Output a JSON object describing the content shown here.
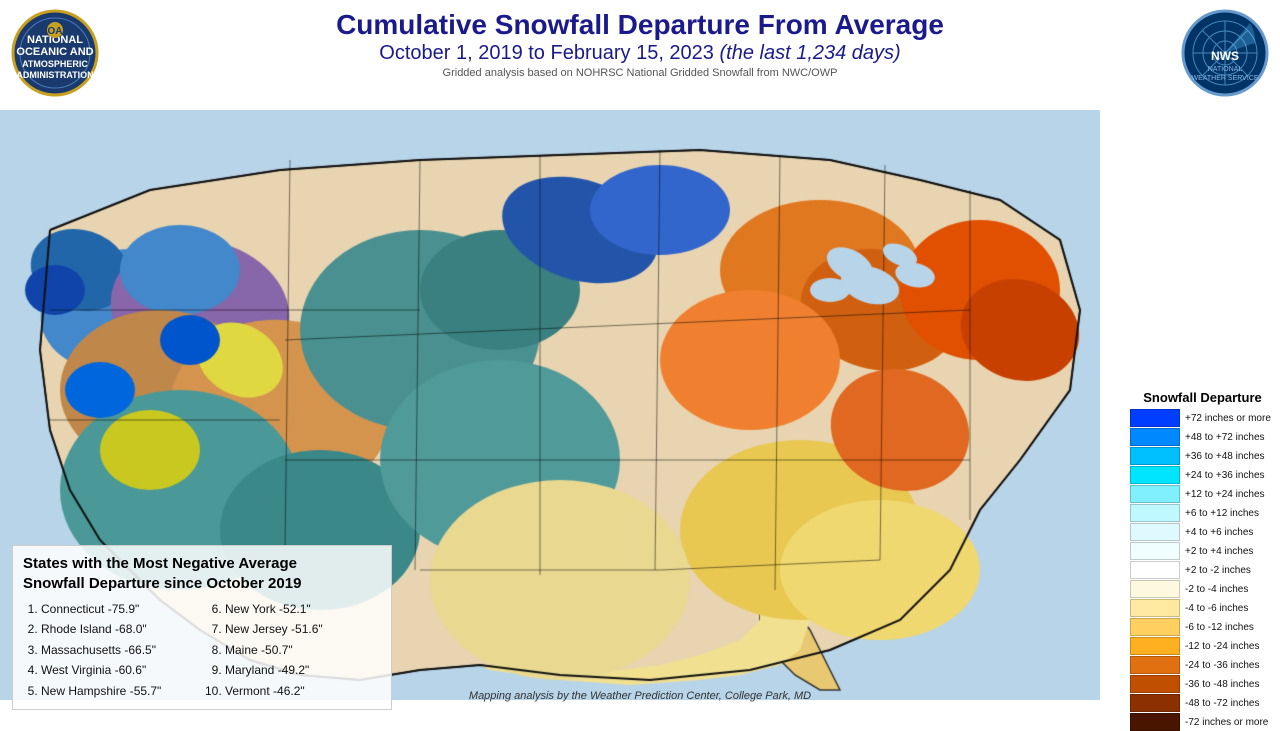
{
  "header": {
    "main_title": "Cumulative Snowfall Departure From Average",
    "subtitle_start": "October 1, 2019 to February 15, 2023",
    "subtitle_italic": "(the last 1,234 days)",
    "gridded_note": "Gridded analysis based on NOHRSC National Gridded Snowfall from NWC/OWP"
  },
  "bottom_left": {
    "title": "States with the Most Negative Average\nSnowfall Departure since October 2019",
    "col1": [
      "Connecticut -75.9\"",
      "Rhode Island -68.0\"",
      "Massachusetts -66.5\"",
      "West Virginia -60.6\"",
      "New Hampshire -55.7\""
    ],
    "col2": [
      "New York -52.1\"",
      "New Jersey -51.6\"",
      "Maine -50.7\"",
      "Maryland -49.2\"",
      "Vermont -46.2\""
    ]
  },
  "credit": "Mapping analysis by the Weather Prediction Center, College Park, MD",
  "legend": {
    "title": "Snowfall  Departure",
    "items": [
      {
        "label": "+72 inches or more",
        "color": "#003eff"
      },
      {
        "label": "+48 to +72 inches",
        "color": "#0088ff"
      },
      {
        "label": "+36 to +48 inches",
        "color": "#00bfff"
      },
      {
        "label": "+24 to +36 inches",
        "color": "#00e5ff"
      },
      {
        "label": "+12 to +24 inches",
        "color": "#80f0ff"
      },
      {
        "label": "+6 to +12 inches",
        "color": "#c0f8ff"
      },
      {
        "label": "+4 to +6 inches",
        "color": "#dffaff"
      },
      {
        "label": "+2 to +4 inches",
        "color": "#f0feff"
      },
      {
        "label": "+2 to -2 inches",
        "color": "#ffffff"
      },
      {
        "label": "-2 to -4 inches",
        "color": "#fff8e0"
      },
      {
        "label": "-4 to -6 inches",
        "color": "#ffe8a0"
      },
      {
        "label": "-6 to -12 inches",
        "color": "#ffd060"
      },
      {
        "label": "-12 to -24 inches",
        "color": "#ffb020"
      },
      {
        "label": "-24 to -36 inches",
        "color": "#e07010"
      },
      {
        "label": "-36 to -48 inches",
        "color": "#c05000"
      },
      {
        "label": "-48 to -72 inches",
        "color": "#8b3000"
      },
      {
        "label": "-72 inches or more",
        "color": "#4a1500"
      }
    ]
  }
}
